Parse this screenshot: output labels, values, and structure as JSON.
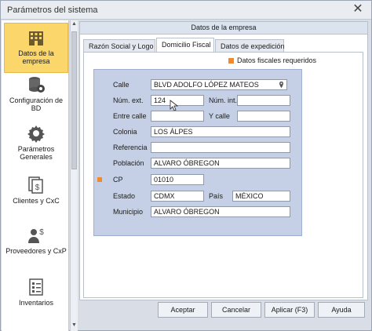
{
  "window": {
    "title": "Parámetros del sistema",
    "close_glyph": "✕"
  },
  "sidebar": {
    "items": [
      {
        "label": "Datos de la empresa",
        "icon": "building-icon"
      },
      {
        "label": "Configuración de BD",
        "icon": "database-gear-icon"
      },
      {
        "label": "Parámetros Generales",
        "icon": "gear-icon"
      },
      {
        "label": "Clientes y CxC",
        "icon": "documents-money-icon"
      },
      {
        "label": "Proveedores y CxP",
        "icon": "person-money-icon"
      },
      {
        "label": "Inventarios",
        "icon": "checklist-icon"
      }
    ]
  },
  "panel": {
    "header": "Datos de la empresa",
    "tabs": [
      {
        "label": "Razón Social y Logo"
      },
      {
        "label": "Domicilio Fiscal"
      },
      {
        "label": "Datos de expedición"
      }
    ],
    "legend": "Datos fiscales requeridos",
    "legend_color": "#f08a2b"
  },
  "form": {
    "calle": {
      "label": "Calle",
      "value": "BLVD ADOLFO LÓPEZ MATEOS"
    },
    "num_ext": {
      "label": "Núm. ext.",
      "value": "124"
    },
    "num_int": {
      "label": "Núm. int.",
      "value": ""
    },
    "entre_calle": {
      "label": "Entre calle",
      "value": ""
    },
    "y_calle": {
      "label": "Y calle",
      "value": ""
    },
    "colonia": {
      "label": "Colonia",
      "value": "LOS ÁLPES"
    },
    "referencia": {
      "label": "Referencia",
      "value": ""
    },
    "poblacion": {
      "label": "Población",
      "value": "ALVARO ÓBREGON"
    },
    "cp": {
      "label": "CP",
      "value": "01010"
    },
    "estado": {
      "label": "Estado",
      "value": "CDMX"
    },
    "pais": {
      "label": "País",
      "value": "MÉXICO"
    },
    "municipio": {
      "label": "Municipio",
      "value": "ALVARO ÓBREGON"
    }
  },
  "footer": {
    "aceptar": "Aceptar",
    "cancelar": "Cancelar",
    "aplicar": "Aplicar (F3)",
    "ayuda": "Ayuda"
  }
}
